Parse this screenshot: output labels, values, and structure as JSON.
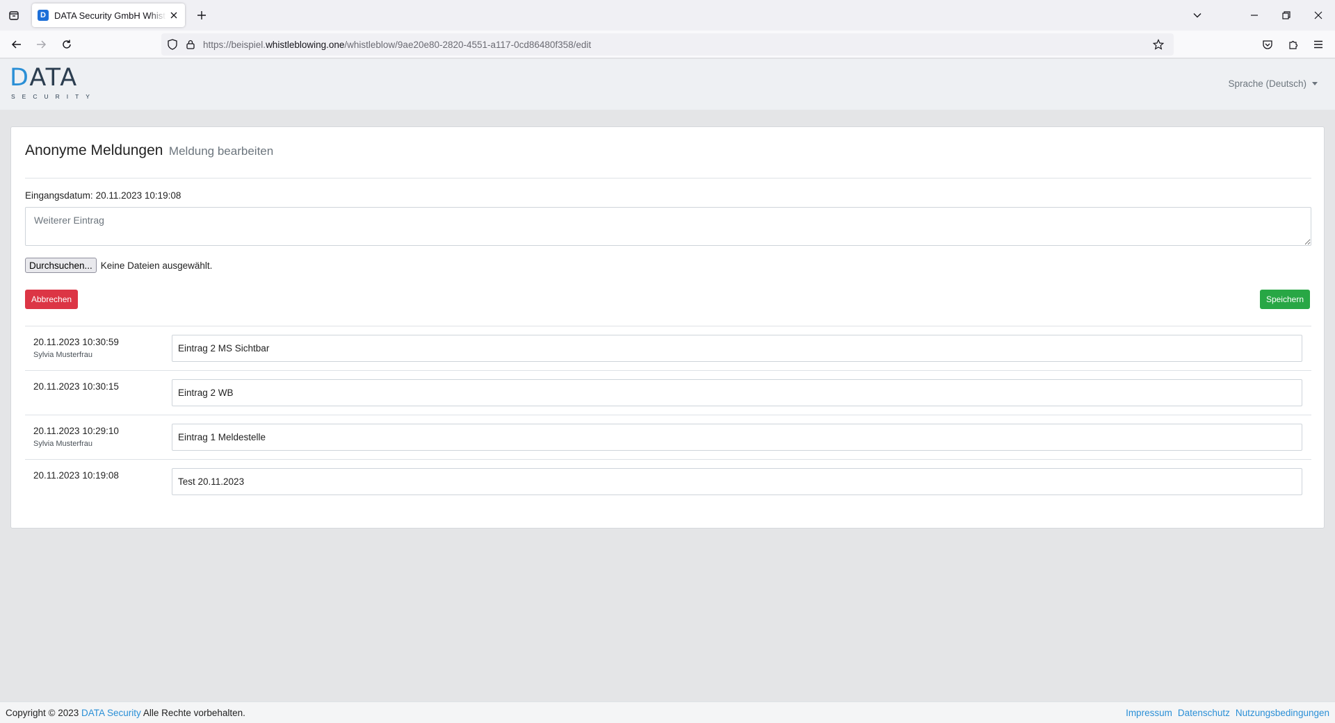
{
  "browser": {
    "tab_title": "DATA Security GmbH Whistleblowing",
    "favicon_letter": "D",
    "url_prefix": "https://beispiel.",
    "url_host": "whistleblowing.one",
    "url_path": "/whistleblow/9ae20e80-2820-4551-a117-0cd86480f358/edit",
    "icons": {
      "list_all_tabs": "list-all-tabs-icon",
      "close_tab": "close-icon",
      "new_tab": "plus-icon",
      "tab_overflow": "chevron-down-icon",
      "minimize": "minimize-icon",
      "restore": "restore-icon",
      "close_window": "close-icon",
      "back": "arrow-left-icon",
      "forward": "arrow-right-icon",
      "reload": "reload-icon",
      "tracking_protection": "shield-icon",
      "lock": "lock-icon",
      "bookmark": "star-icon",
      "pocket": "pocket-icon",
      "extensions": "puzzle-icon",
      "menu": "hamburger-icon"
    }
  },
  "header": {
    "logo_text": "DATA",
    "logo_subtext": "SECURITY",
    "language_label": "Sprache (Deutsch)"
  },
  "card": {
    "title": "Anonyme Meldungen",
    "subtitle": "Meldung bearbeiten",
    "received_label": "Eingangsdatum:",
    "received_value": "20.11.2023 10:19:08",
    "textarea_placeholder": "Weiterer Eintrag",
    "file_button": "Durchsuchen...",
    "file_status": "Keine Dateien ausgewählt.",
    "cancel_label": "Abbrechen",
    "save_label": "Speichern"
  },
  "entries": [
    {
      "date": "20.11.2023 10:30:59",
      "author": "Sylvia Musterfrau",
      "text": "Eintrag 2 MS Sichtbar"
    },
    {
      "date": "20.11.2023 10:30:15",
      "author": "",
      "text": "Eintrag 2 WB"
    },
    {
      "date": "20.11.2023 10:29:10",
      "author": "Sylvia Musterfrau",
      "text": "Eintrag 1 Meldestelle"
    },
    {
      "date": "20.11.2023 10:19:08",
      "author": "",
      "text": "Test 20.11.2023"
    }
  ],
  "footer": {
    "copyright_prefix": "Copyright © 2023",
    "copyright_link": "DATA Security",
    "copyright_suffix": "Alle Rechte vorbehalten.",
    "links": [
      "Impressum",
      "Datenschutz",
      "Nutzungsbedingungen"
    ]
  },
  "colors": {
    "accent_blue": "#2a8fd6",
    "danger": "#dc3545",
    "success": "#28a745",
    "page_bg": "#e4e5e7"
  }
}
